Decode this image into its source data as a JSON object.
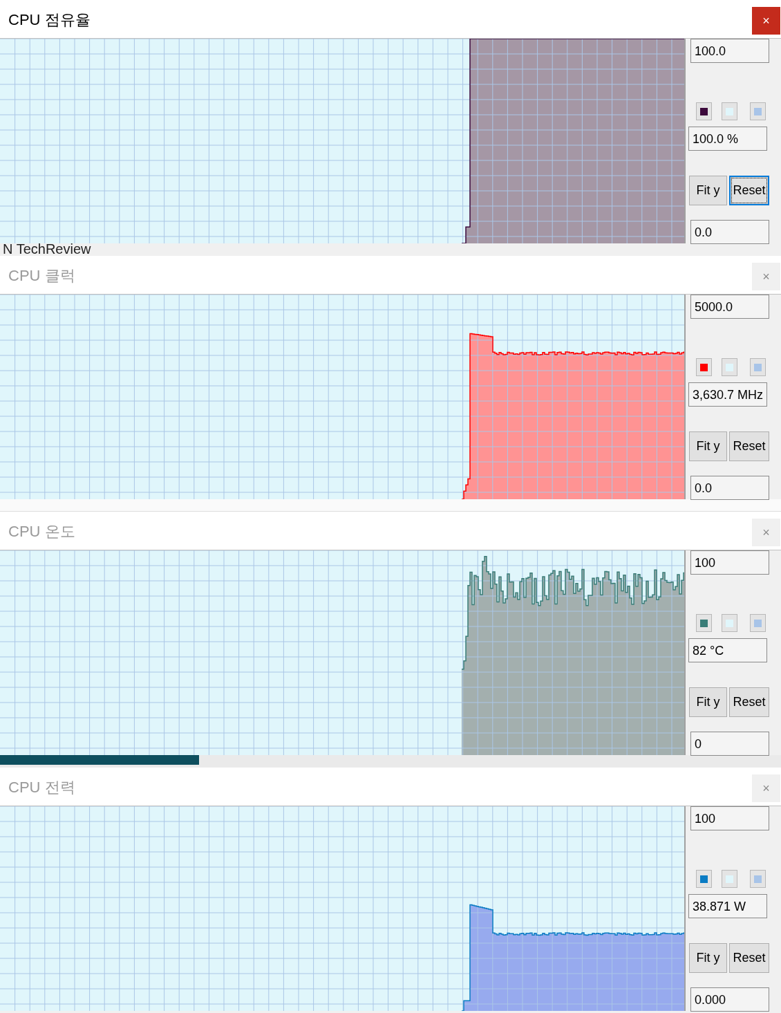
{
  "windows": [
    {
      "title": "CPU 점유율",
      "active": true,
      "close": "×",
      "kind": "usage",
      "swatches": [
        {
          "color": "#3c0a3c"
        },
        {
          "color": "#e0f6fb"
        },
        {
          "color": "#a8c4e8"
        }
      ],
      "max": "100.0",
      "current": "100.0 %",
      "min": "0.0",
      "buttons": [
        {
          "label": "Fit y",
          "focused": false
        },
        {
          "label": "Reset",
          "focused": true
        }
      ]
    },
    {
      "title": "CPU 클럭",
      "active": false,
      "close": "×",
      "kind": "clock",
      "swatches": [
        {
          "color": "#ff0000"
        },
        {
          "color": "#e0f6fb"
        },
        {
          "color": "#a8c4e8"
        }
      ],
      "max": "5000.0",
      "current": "3,630.7 MHz",
      "min": "0.0",
      "buttons": [
        {
          "label": "Fit y",
          "focused": false
        },
        {
          "label": "Reset",
          "focused": false
        }
      ]
    },
    {
      "title": "CPU 온도",
      "active": false,
      "close": "×",
      "kind": "temp",
      "swatches": [
        {
          "color": "#3a7d78"
        },
        {
          "color": "#e0f6fb"
        },
        {
          "color": "#a8c4e8"
        }
      ],
      "max": "100",
      "current": "82 °C",
      "min": "0",
      "buttons": [
        {
          "label": "Fit y",
          "focused": false
        },
        {
          "label": "Reset",
          "focused": false
        }
      ]
    },
    {
      "title": "CPU 전력",
      "active": false,
      "close": "×",
      "kind": "power",
      "swatches": [
        {
          "color": "#0a7cc4"
        },
        {
          "color": "#e0f6fb"
        },
        {
          "color": "#a8c4e8"
        }
      ],
      "max": "100",
      "current": "38.871 W",
      "min": "0.000",
      "buttons": [
        {
          "label": "Fit y",
          "focused": false
        },
        {
          "label": "Reset",
          "focused": false
        }
      ]
    }
  ],
  "background_strips": [
    {
      "kind": "menu",
      "text": "N TechReview"
    },
    {
      "kind": "tree"
    },
    {
      "kind": "teal"
    }
  ]
}
